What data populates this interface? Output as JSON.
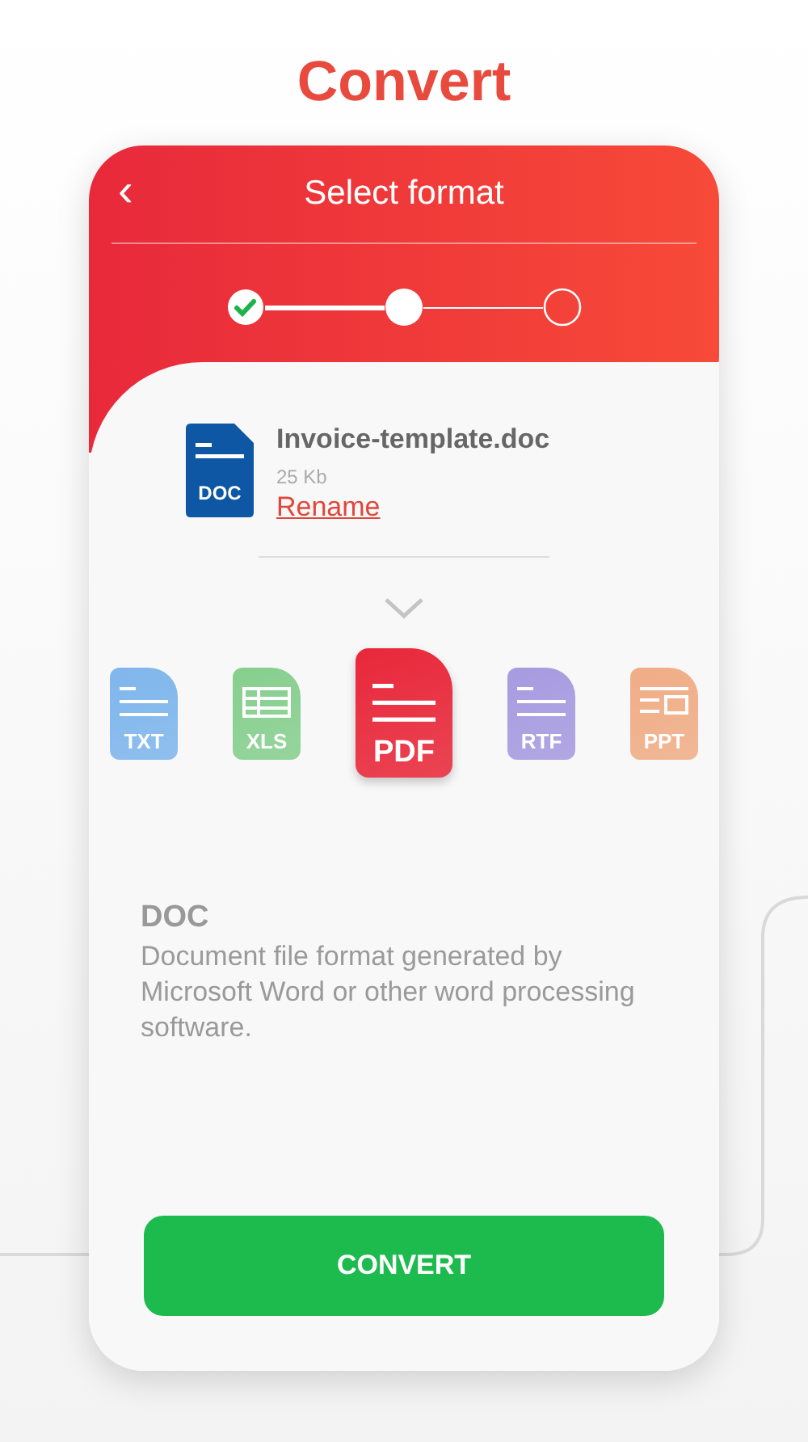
{
  "heading": "Convert",
  "window": {
    "title": "Select format",
    "back": "‹"
  },
  "steps": [
    {
      "kind": "done"
    },
    {
      "kind": "current"
    },
    {
      "kind": "pending"
    }
  ],
  "file": {
    "type": "DOC",
    "name": "Invoice-template.doc",
    "size": "25 Kb",
    "rename": "Rename"
  },
  "formats": [
    {
      "label": "TXT",
      "kind": "lines",
      "color": "#7fb6ec",
      "selected": false
    },
    {
      "label": "XLS",
      "kind": "grid",
      "color": "#86cf8e",
      "selected": false
    },
    {
      "label": "PDF",
      "kind": "lines",
      "color": "#e8283a",
      "selected": true
    },
    {
      "label": "RTF",
      "kind": "lines",
      "color": "#a79be0",
      "selected": false
    },
    {
      "label": "PPT",
      "kind": "slide",
      "color": "#f0ad86",
      "selected": false
    }
  ],
  "description": {
    "title": "DOC",
    "text": "Document file format generated by Microsoft Word or other word processing software."
  },
  "button": "CONVERT"
}
